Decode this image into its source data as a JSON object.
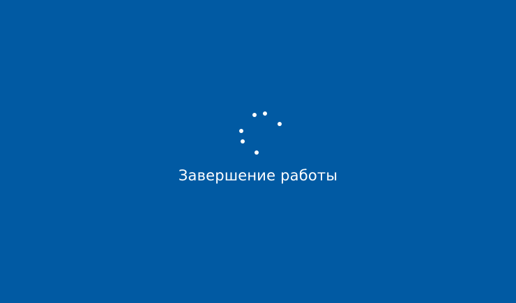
{
  "screen": {
    "status_text": "Завершение работы",
    "background_color": "#015aa3",
    "foreground_color": "#ffffff"
  },
  "spinner": {
    "icon": "loading-spinner-icon",
    "dot_count": 6
  }
}
